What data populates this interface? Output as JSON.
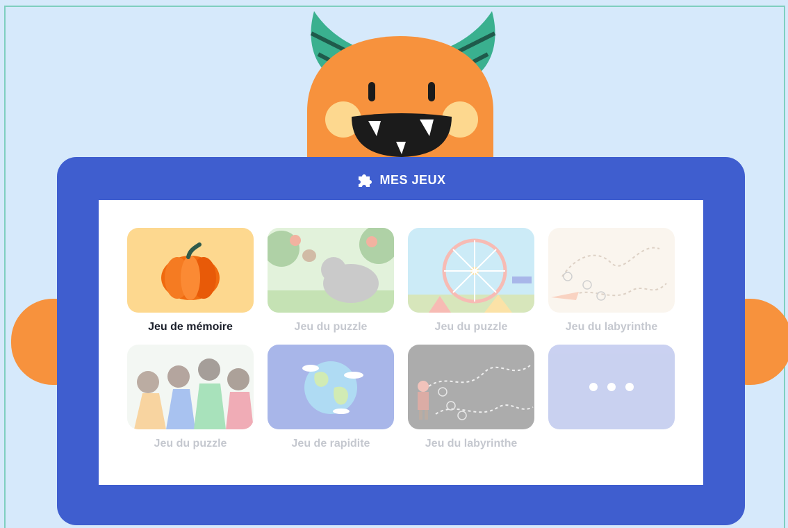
{
  "header": {
    "title": "MES JEUX",
    "icon": "puzzle-icon"
  },
  "colors": {
    "background": "#d6e9fb",
    "tablet": "#3f5ecf",
    "monster_body": "#f7923d",
    "monster_horn": "#3ab08f",
    "memory_card": "#fdd88f",
    "more_card": "#8a9ae0"
  },
  "games": [
    {
      "label": "Jeu de mémoire",
      "active": true,
      "art": "pumpkin"
    },
    {
      "label": "Jeu du puzzle",
      "active": false,
      "art": "jungle"
    },
    {
      "label": "Jeu du puzzle",
      "active": false,
      "art": "ferris-wheel"
    },
    {
      "label": "Jeu du labyrinthe",
      "active": false,
      "art": "maze-plane"
    },
    {
      "label": "Jeu du puzzle",
      "active": false,
      "art": "kids-heroes"
    },
    {
      "label": "Jeu de rapidite",
      "active": false,
      "art": "earth"
    },
    {
      "label": "Jeu du labyrinthe",
      "active": false,
      "art": "maze-pirate"
    },
    {
      "label": "",
      "active": false,
      "art": "more-dots"
    }
  ]
}
